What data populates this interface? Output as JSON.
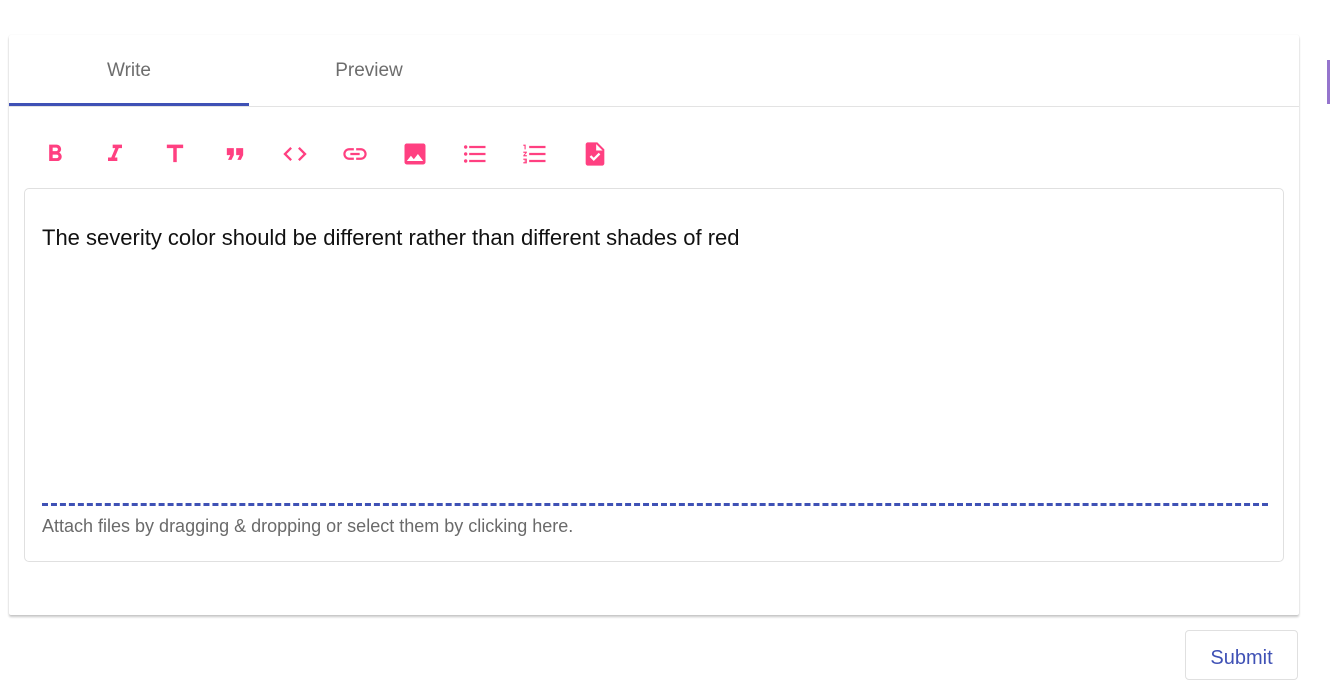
{
  "tabs": [
    {
      "label": "Write",
      "active": true
    },
    {
      "label": "Preview",
      "active": false
    }
  ],
  "toolbar": {
    "color": "#ff4081",
    "tools": [
      {
        "name": "bold",
        "icon": "bold-icon"
      },
      {
        "name": "italic",
        "icon": "italic-icon"
      },
      {
        "name": "heading",
        "icon": "heading-icon"
      },
      {
        "name": "quote",
        "icon": "quote-icon"
      },
      {
        "name": "code",
        "icon": "code-icon"
      },
      {
        "name": "link",
        "icon": "link-icon"
      },
      {
        "name": "image",
        "icon": "image-icon"
      },
      {
        "name": "bulleted-list",
        "icon": "bulleted-list-icon"
      },
      {
        "name": "numbered-list",
        "icon": "numbered-list-icon"
      },
      {
        "name": "task-list",
        "icon": "task-file-icon"
      }
    ]
  },
  "editor": {
    "text": "The severity color should be different rather than different shades of red",
    "attach_hint": "Attach files by dragging & dropping or select them by clicking here."
  },
  "actions": {
    "submit_label": "Submit"
  },
  "colors": {
    "accent": "#3f51b5",
    "icon": "#ff4081"
  }
}
